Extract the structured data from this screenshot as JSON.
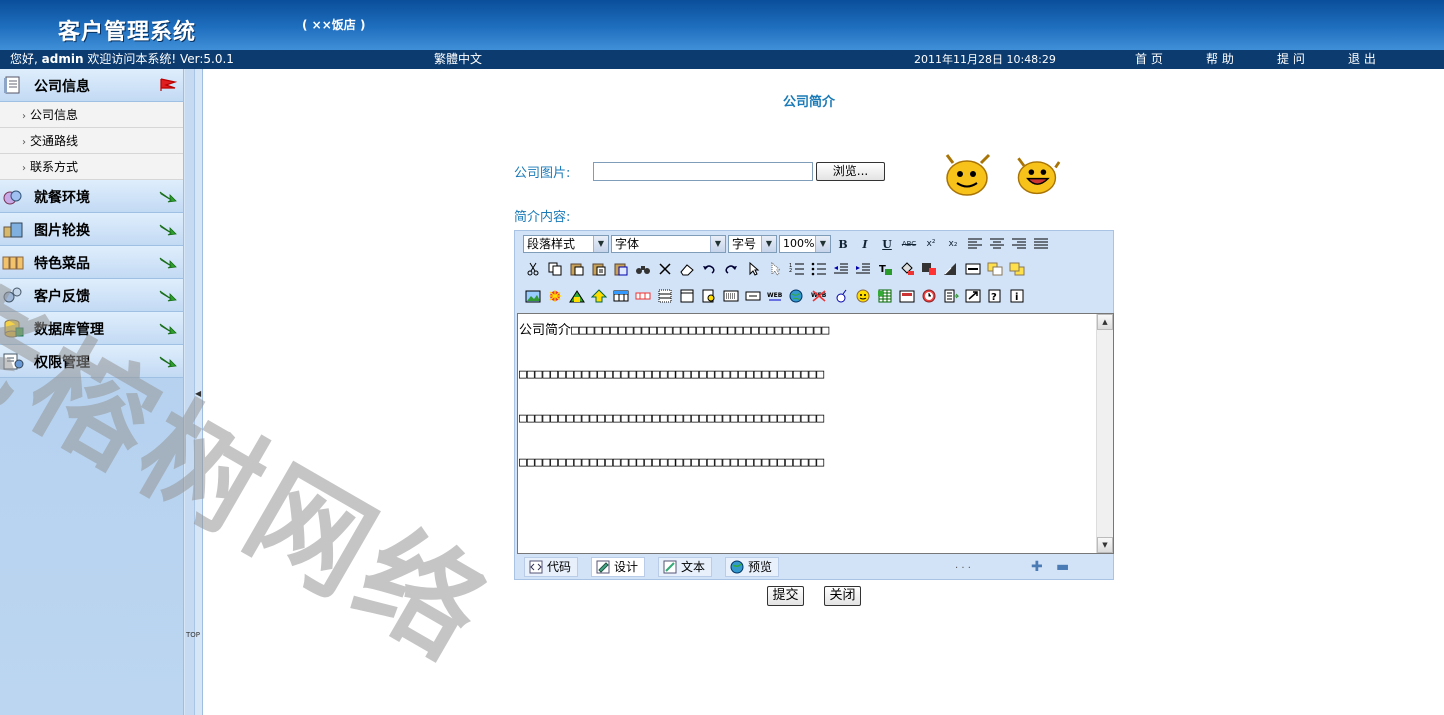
{
  "header": {
    "app_title": "客户管理系统",
    "subtitle": "( ××饭店 )"
  },
  "infobar": {
    "greeting_prefix": "您好, ",
    "user": "admin",
    "greeting_suffix": " 欢迎访问本系统! Ver:5.0.1",
    "traditional_chinese": "繁體中文",
    "datetime": "2011年11月28日 10:48:29",
    "nav": [
      "首 页",
      "帮 助",
      "提 问",
      "退 出"
    ]
  },
  "sidebar": {
    "items": [
      {
        "label": "公司信息",
        "icon": "book-icon",
        "expanded": true,
        "subitems": [
          "公司信息",
          "交通路线",
          "联系方式"
        ]
      },
      {
        "label": "就餐环境",
        "icon": "environment-icon"
      },
      {
        "label": "图片轮换",
        "icon": "pictures-icon"
      },
      {
        "label": "特色菜品",
        "icon": "dishes-icon"
      },
      {
        "label": "客户反馈",
        "icon": "feedback-icon"
      },
      {
        "label": "数据库管理",
        "icon": "database-icon"
      },
      {
        "label": "权限管理",
        "icon": "permissions-icon"
      }
    ]
  },
  "splitter": {
    "toggle": "◀",
    "top_label": "TOP"
  },
  "main": {
    "page_title": "公司简介",
    "photo_label": "公司图片:",
    "photo_value": "",
    "browse_label": "浏览...",
    "content_label": "简介内容:",
    "submit_label": "提交",
    "close_label": "关闭"
  },
  "editor": {
    "paragraph_style": "段落样式",
    "font": "字体",
    "font_size": "字号",
    "zoom": "100%",
    "content": "公司简介□□□□□□□□□□□□□□□□□□□□□□□□□□□□□□□□□\n\n□□□□□□□□□□□□□□□□□□□□□□□□□□□□□□□□□□□□□□□\n\n□□□□□□□□□□□□□□□□□□□□□□□□□□□□□□□□□□□□□□□\n\n□□□□□□□□□□□□□□□□□□□□□□□□□□□□□□□□□□□□□□□",
    "modes": [
      "代码",
      "设计",
      "文本",
      "预览"
    ],
    "active_mode": "设计",
    "status_dots": ". . ."
  },
  "watermark": "老榕树网络",
  "colors": {
    "header_blue": "#1f6fbf",
    "infobar_navy": "#0c3b6f",
    "label_blue": "#1a7ab7",
    "sidebar_blue": "#c3daf4"
  }
}
